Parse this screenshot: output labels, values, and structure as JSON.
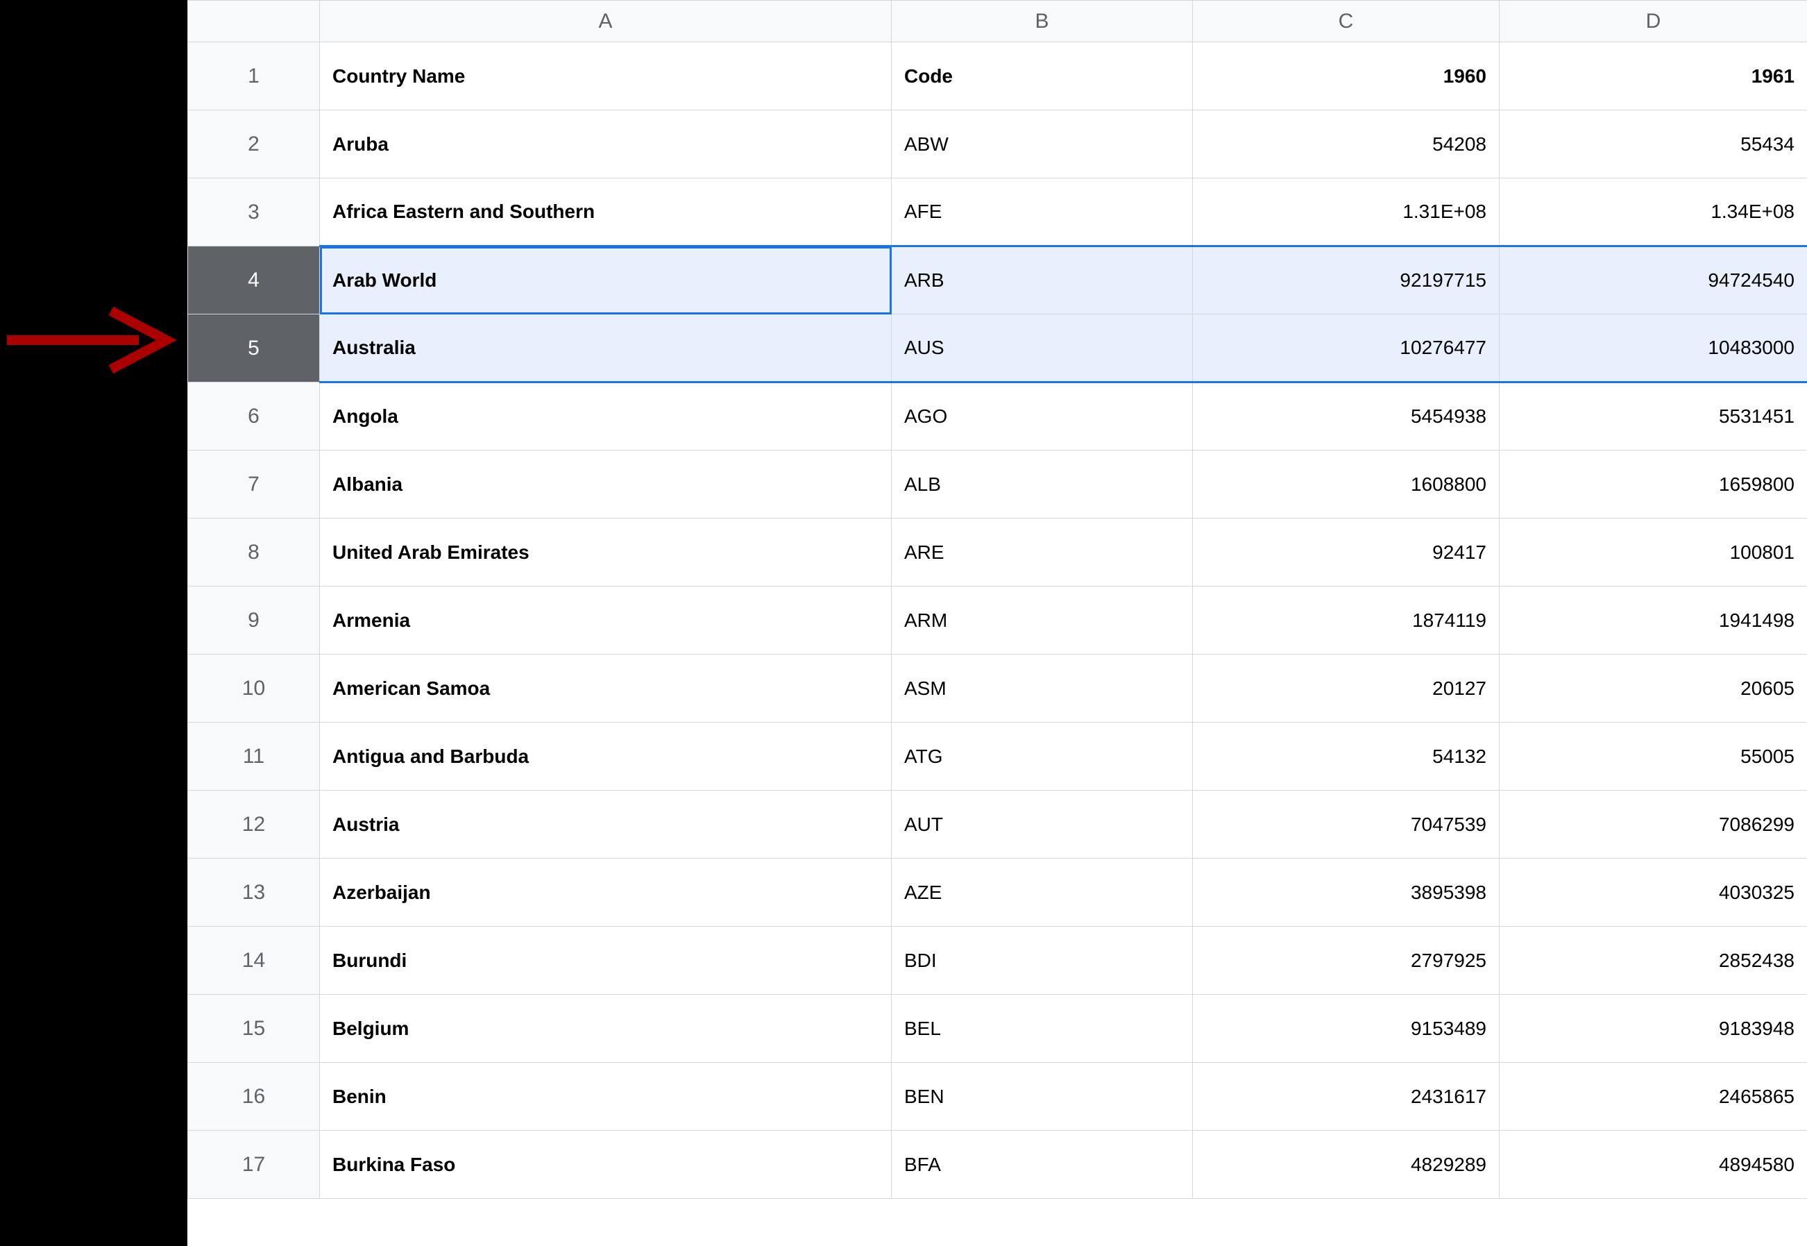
{
  "annotation": {
    "arrow_target_row": 4,
    "color": "#aa0000"
  },
  "columns": [
    "A",
    "B",
    "C",
    "D"
  ],
  "header_row": {
    "a": "Country Name",
    "b": "Code",
    "c": "1960",
    "d": "1961"
  },
  "rows": [
    {
      "n": 1,
      "a": "Country Name",
      "b": "Code",
      "c": "1960",
      "d": "1961"
    },
    {
      "n": 2,
      "a": "Aruba",
      "b": "ABW",
      "c": "54208",
      "d": "55434"
    },
    {
      "n": 3,
      "a": "Africa Eastern and Southern",
      "b": "AFE",
      "c": "1.31E+08",
      "d": "1.34E+08"
    },
    {
      "n": 4,
      "a": "Arab World",
      "b": "ARB",
      "c": "92197715",
      "d": "94724540"
    },
    {
      "n": 5,
      "a": "Australia",
      "b": "AUS",
      "c": "10276477",
      "d": "10483000"
    },
    {
      "n": 6,
      "a": "Angola",
      "b": "AGO",
      "c": "5454938",
      "d": "5531451"
    },
    {
      "n": 7,
      "a": "Albania",
      "b": "ALB",
      "c": "1608800",
      "d": "1659800"
    },
    {
      "n": 8,
      "a": "United Arab Emirates",
      "b": "ARE",
      "c": "92417",
      "d": "100801"
    },
    {
      "n": 9,
      "a": "Armenia",
      "b": "ARM",
      "c": "1874119",
      "d": "1941498"
    },
    {
      "n": 10,
      "a": "American Samoa",
      "b": "ASM",
      "c": "20127",
      "d": "20605"
    },
    {
      "n": 11,
      "a": "Antigua and Barbuda",
      "b": "ATG",
      "c": "54132",
      "d": "55005"
    },
    {
      "n": 12,
      "a": "Austria",
      "b": "AUT",
      "c": "7047539",
      "d": "7086299"
    },
    {
      "n": 13,
      "a": "Azerbaijan",
      "b": "AZE",
      "c": "3895398",
      "d": "4030325"
    },
    {
      "n": 14,
      "a": "Burundi",
      "b": "BDI",
      "c": "2797925",
      "d": "2852438"
    },
    {
      "n": 15,
      "a": "Belgium",
      "b": "BEL",
      "c": "9153489",
      "d": "9183948"
    },
    {
      "n": 16,
      "a": "Benin",
      "b": "BEN",
      "c": "2431617",
      "d": "2465865"
    },
    {
      "n": 17,
      "a": "Burkina Faso",
      "b": "BFA",
      "c": "4829289",
      "d": "4894580"
    }
  ],
  "selection": {
    "from_row": 4,
    "to_row": 5,
    "active_cell": "A4"
  },
  "chart_data": {
    "type": "table",
    "title": "",
    "columns": [
      "Country Name",
      "Code",
      "1960",
      "1961"
    ],
    "rows": [
      [
        "Aruba",
        "ABW",
        54208,
        55434
      ],
      [
        "Africa Eastern and Southern",
        "AFE",
        131000000.0,
        134000000.0
      ],
      [
        "Arab World",
        "ARB",
        92197715,
        94724540
      ],
      [
        "Australia",
        "AUS",
        10276477,
        10483000
      ],
      [
        "Angola",
        "AGO",
        5454938,
        5531451
      ],
      [
        "Albania",
        "ALB",
        1608800,
        1659800
      ],
      [
        "United Arab Emirates",
        "ARE",
        92417,
        100801
      ],
      [
        "Armenia",
        "ARM",
        1874119,
        1941498
      ],
      [
        "American Samoa",
        "ASM",
        20127,
        20605
      ],
      [
        "Antigua and Barbuda",
        "ATG",
        54132,
        55005
      ],
      [
        "Austria",
        "AUT",
        7047539,
        7086299
      ],
      [
        "Azerbaijan",
        "AZE",
        3895398,
        4030325
      ],
      [
        "Burundi",
        "BDI",
        2797925,
        2852438
      ],
      [
        "Belgium",
        "BEL",
        9153489,
        9183948
      ],
      [
        "Benin",
        "BEN",
        2431617,
        2465865
      ],
      [
        "Burkina Faso",
        "BFA",
        4829289,
        4894580
      ]
    ]
  }
}
